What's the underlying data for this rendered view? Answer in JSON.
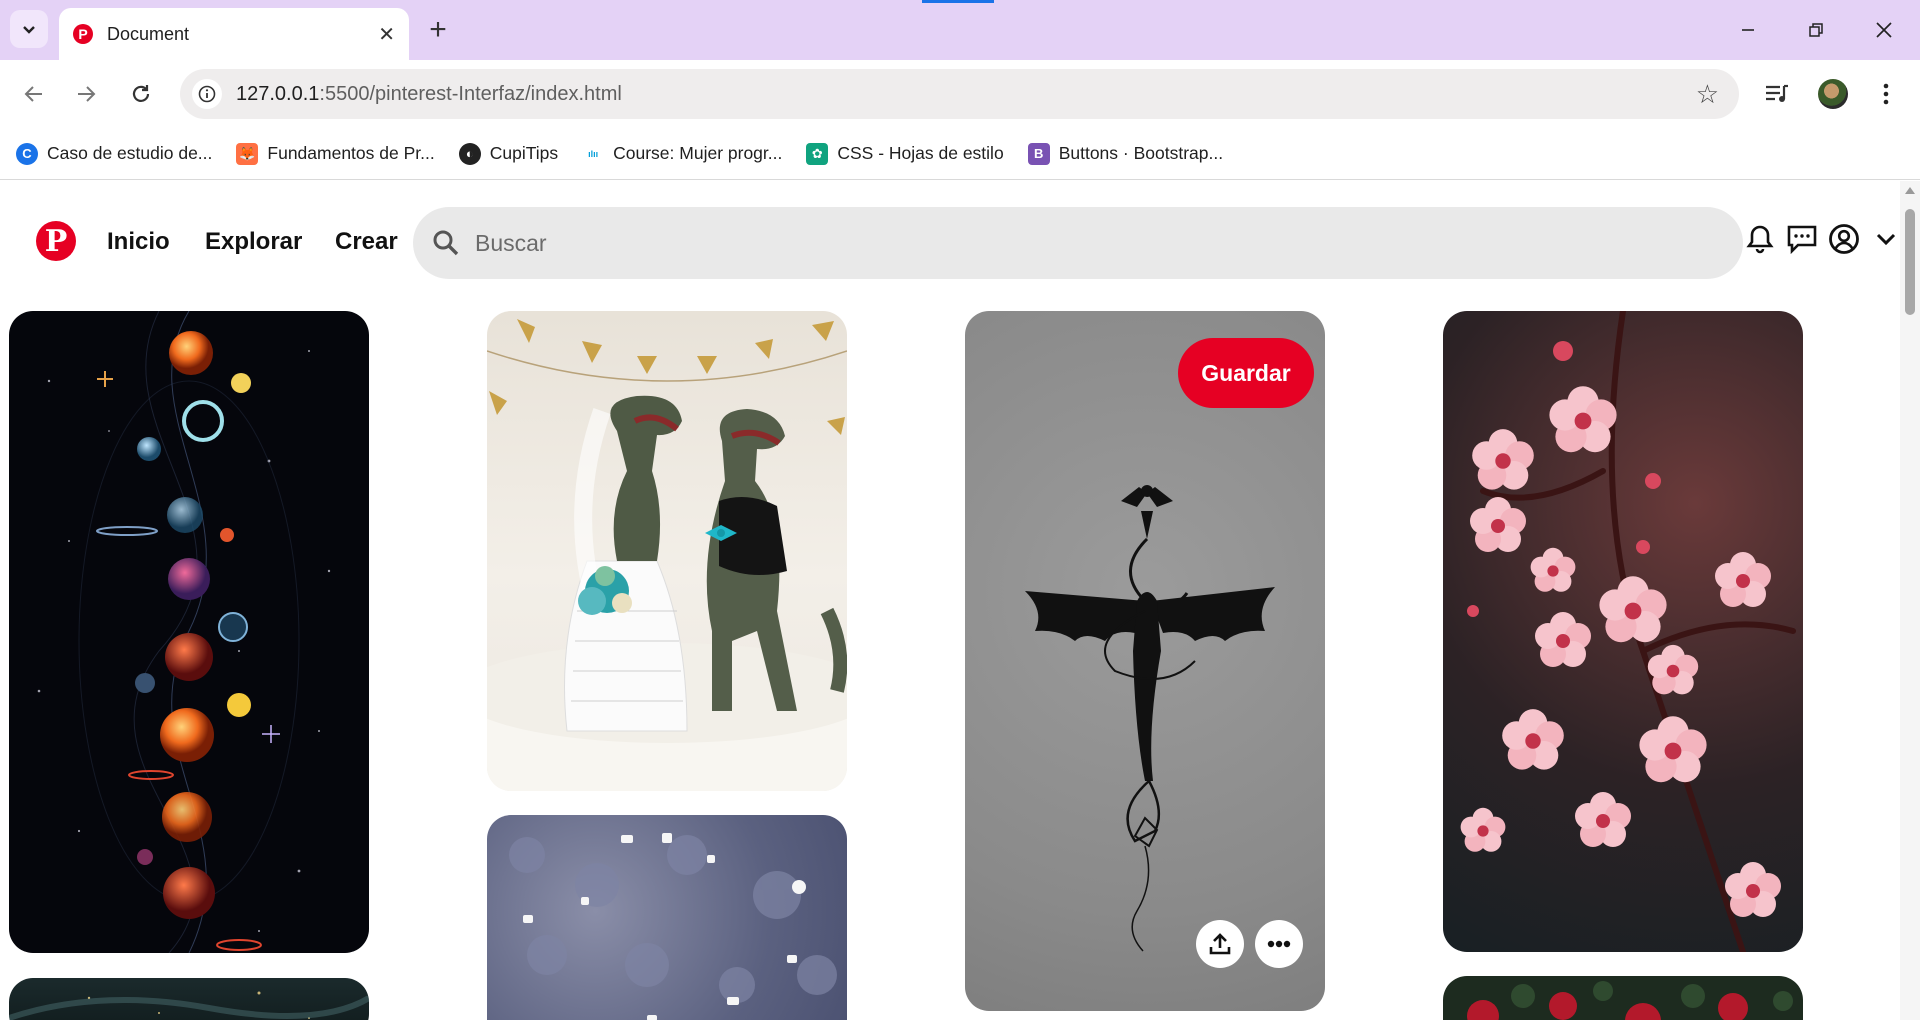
{
  "browser": {
    "tab_title": "Document",
    "url_host": "127.0.0.1",
    "url_path": ":5500/pinterest-Interfaz/index.html",
    "accent": "#e4d2f6"
  },
  "bookmarks": [
    {
      "label": "Caso de estudio de...",
      "icon": "c-logo-icon",
      "color": "#1a73e8"
    },
    {
      "label": "Fundamentos de Pr...",
      "icon": "fox-logo-icon",
      "color": "#ff7043"
    },
    {
      "label": "CupiTips",
      "icon": "globe-icon",
      "color": "#222222"
    },
    {
      "label": "Course: Mujer progr...",
      "icon": "cisco-logo-icon",
      "color": "#049fd9"
    },
    {
      "label": "CSS - Hojas de estilo",
      "icon": "openai-logo-icon",
      "color": "#10a37f"
    },
    {
      "label": "Buttons · Bootstrap...",
      "icon": "bootstrap-logo-icon",
      "color": "#7952b3"
    }
  ],
  "header": {
    "logo": "P",
    "nav": [
      "Inicio",
      "Explorar",
      "Crear"
    ],
    "search_placeholder": "Buscar"
  },
  "pins": {
    "save_label": "Guardar",
    "items": [
      "planets-pin",
      "dinosaur-wedding-pin",
      "dragon-tattoo-pin",
      "cherry-blossom-pin",
      "night-sky-pin",
      "glitter-pin",
      "red-roses-pin"
    ]
  },
  "colors": {
    "brand": "#e60023"
  }
}
